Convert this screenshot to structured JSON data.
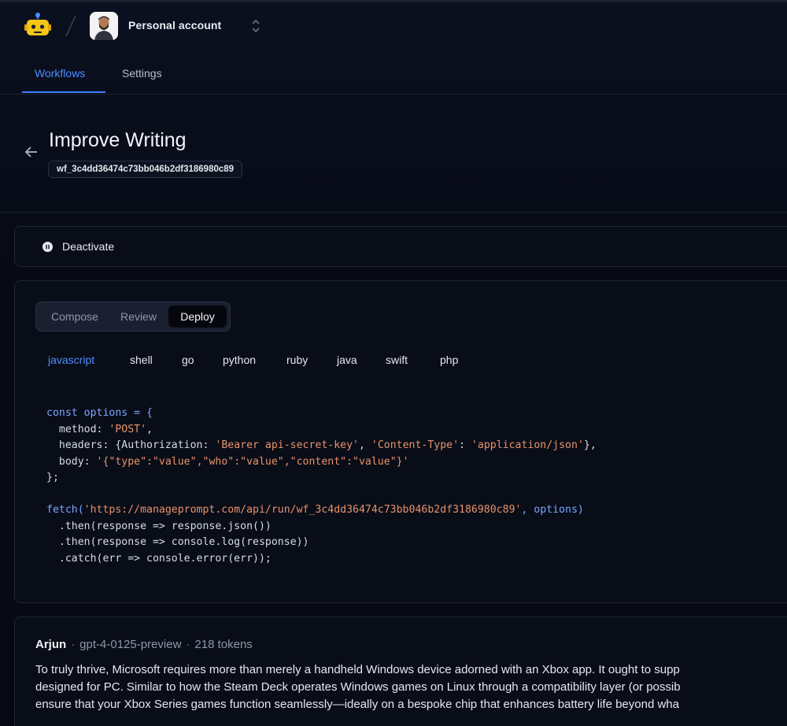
{
  "header": {
    "account_name": "Personal account",
    "tabs": [
      {
        "label": "Workflows",
        "active": true
      },
      {
        "label": "Settings",
        "active": false
      }
    ],
    "accent_color": "#3f7fff"
  },
  "workflow": {
    "title": "Improve Writing",
    "id": "wf_3c4dd36474c73bb046b2df3186980c89"
  },
  "actions": {
    "deactivate_label": "Deactivate"
  },
  "modes": {
    "compose": "Compose",
    "review": "Review",
    "deploy": "Deploy",
    "selected": "Deploy"
  },
  "languages": [
    "javascript",
    "shell",
    "go",
    "python",
    "ruby",
    "java",
    "swift",
    "php"
  ],
  "selected_language": "javascript",
  "code": {
    "l1_a": "const options = {",
    "l2_a": "  method: ",
    "l2_b": "'POST'",
    "l2_c": ",",
    "l3_a": "  headers: {Authorization: ",
    "l3_b": "'Bearer api-secret-key'",
    "l3_c": ", ",
    "l3_d": "'Content-Type'",
    "l3_e": ": ",
    "l3_f": "'application/json'",
    "l3_g": "},",
    "l4_a": "  body: ",
    "l4_b": "'{\"type\":\"value\",\"who\":\"value\",\"content\":\"value\"}'",
    "l5_a": "};",
    "l7_a": "fetch(",
    "l7_b": "'https://manageprompt.com/api/run/wf_3c4dd36474c73bb046b2df3186980c89'",
    "l7_c": ", options)",
    "l8_a": "  .then(response => response.json())",
    "l9_a": "  .then(response => console.log(response))",
    "l10_a": "  .catch(err => console.error(err));"
  },
  "message": {
    "author": "Arjun",
    "model": "gpt-4-0125-preview",
    "tokens": "218 tokens",
    "lines": [
      "To truly thrive, Microsoft requires more than merely a handheld Windows device adorned with an Xbox app. It ought to supp",
      "designed for PC. Similar to how the Steam Deck operates Windows games on Linux through a compatibility layer (or possib",
      "ensure that your Xbox Series games function seamlessly—ideally on a bespoke chip that enhances battery life beyond wha"
    ]
  }
}
